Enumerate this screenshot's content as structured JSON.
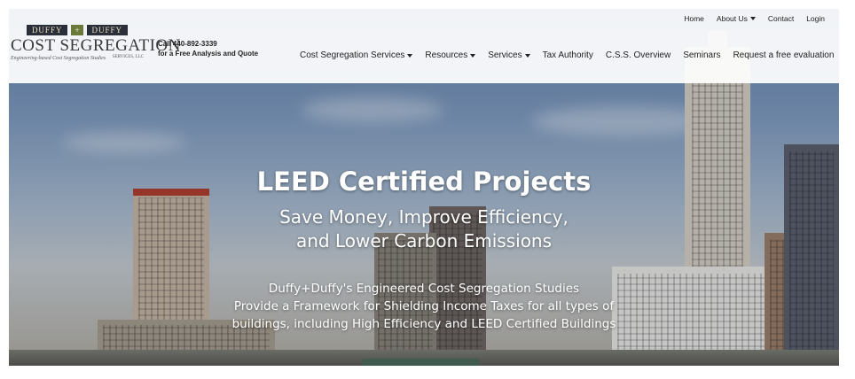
{
  "logo": {
    "top_left": "DUFFY",
    "plus": "+",
    "top_right": "DUFFY",
    "main": "COST SEGREGATION",
    "services": "SERVICES, LLC",
    "tagline": "Engineering-based Cost Segregation Studies"
  },
  "cta": {
    "line1": "Call 440-892-3339",
    "line2": "for a Free Analysis and Quote"
  },
  "utility_nav": [
    "Home",
    "About Us",
    "Contact",
    "Login"
  ],
  "main_nav": [
    "Cost Segregation Services",
    "Resources",
    "Services",
    "Tax Authority",
    "C.S.S. Overview",
    "Seminars",
    "Request a free evaluation"
  ],
  "hero": {
    "title": "LEED Certified Projects",
    "subtitle_line1": "Save Money, Improve Efficiency,",
    "subtitle_line2": "and Lower Carbon Emissions",
    "body_line1": "Duffy+Duffy's Engineered Cost Segregation Studies",
    "body_line2": "Provide a Framework for Shielding Income Taxes for all types of",
    "body_line3": "buildings, including High Efficiency and LEED Certified Buildings"
  },
  "colors": {
    "header_bg": "#ffffff",
    "text_dark": "#222222",
    "hero_text": "#ffffff",
    "logo_dark": "#2a2f3a",
    "logo_accent": "#6a7a3a"
  }
}
